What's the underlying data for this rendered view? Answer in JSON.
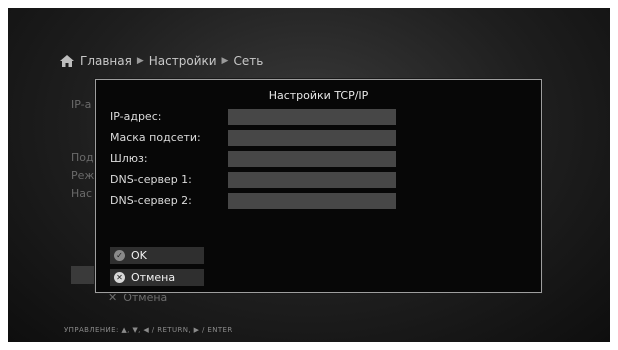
{
  "breadcrumb": {
    "items": [
      "Главная",
      "Настройки",
      "Сеть"
    ],
    "separator": "▶"
  },
  "background": {
    "rows": [
      "IP-а",
      "Под",
      "Реж",
      "Нас"
    ],
    "cancel_label": "Отмена"
  },
  "dialog": {
    "title": "Настройки TCP/IP",
    "fields": [
      {
        "label": "IP-адрес:",
        "value": ""
      },
      {
        "label": "Маска подсети:",
        "value": ""
      },
      {
        "label": "Шлюз:",
        "value": ""
      },
      {
        "label": "DNS-сервер 1:",
        "value": ""
      },
      {
        "label": "DNS-сервер 2:",
        "value": ""
      }
    ],
    "ok_label": "OK",
    "cancel_label": "Отмена"
  },
  "footer": {
    "text": "УПРАВЛЕНИЕ:  ▲, ▼, ◀ / RETURN,  ▶ / ENTER"
  },
  "icons": {
    "home": "home-icon",
    "ok": "check-icon",
    "cancel": "close-icon"
  }
}
